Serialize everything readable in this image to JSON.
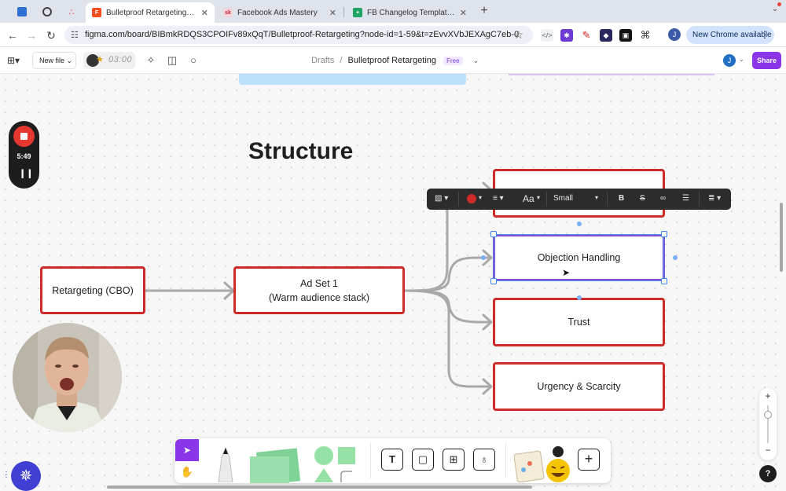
{
  "browser": {
    "tabs": [
      {
        "title": "Bulletproof Retargeting – Fig...",
        "active": true
      },
      {
        "title": "Facebook Ads Mastery",
        "active": false
      },
      {
        "title": "FB Changelog Template - Goo...",
        "active": false
      }
    ],
    "url": "figma.com/board/BIBmkRDQS3CPOIFv89xQqT/Bulletproof-Retargeting?node-id=1-59&t=zEvvXVbJEXAgC7eb-0",
    "chrome_available_label": "New Chrome available",
    "profile_initial": "J"
  },
  "figma": {
    "new_file_label": "New file",
    "timer": "03:00",
    "breadcrumb": {
      "folder": "Drafts",
      "separator": "/",
      "file": "Bulletproof Retargeting",
      "plan": "Free"
    },
    "user_initial": "J",
    "share_label": "Share"
  },
  "board": {
    "heading": "Structure",
    "campaign": "Retargeting (CBO)",
    "adset_line1": "Ad Set 1",
    "adset_line2": "(Warm audience stack)",
    "ad_objection": "Objection Handling",
    "ad_trust": "Trust",
    "ad_urgency": "Urgency & Scarcity"
  },
  "text_toolbar": {
    "font_icon": "Aa",
    "size_value": "Small",
    "colors": {
      "stroke": "#cf2a2a"
    }
  },
  "recorder": {
    "elapsed": "5:49"
  },
  "icons": {
    "accent": "#8a35e8",
    "connector_color": "#a9a9a9",
    "box_border": "#cf2a2a"
  }
}
